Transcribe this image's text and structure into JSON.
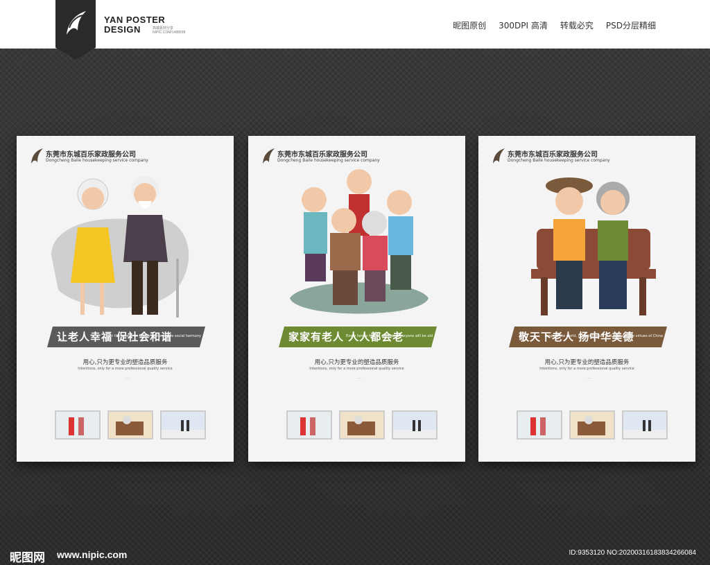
{
  "topbar": {
    "brand_line1": "YAN POSTER",
    "brand_line2": "DESIGN",
    "brand_small": "高端素材分享 NIPIC.COM/1488598",
    "features": [
      "昵图原创",
      "300DPI 高清",
      "转载必究",
      "PSD分层精细"
    ]
  },
  "posters": [
    {
      "company": "东莞市东城百乐家政服务公司",
      "company_en": "Dongcheng Baile housekeeping service company",
      "title": "让老人幸福  促社会和谐",
      "subtitle": "Let the elderly be happy and promote social harmony",
      "banner_color": "#5a5a5a",
      "slogan": "用心,只为更专业的塑造品质服务",
      "slogan_en": "Intentions, only for a more professional quality service",
      "body": "......"
    },
    {
      "company": "东莞市东城百乐家政服务公司",
      "company_en": "Dongcheng Baile housekeeping service company",
      "title": "家家有老人  人人都会老",
      "subtitle": "Every family has an old man, everyone will be old",
      "banner_color": "#6e8a32",
      "slogan": "用心,只为更专业的塑造品质服务",
      "slogan_en": "Intentions, only for a more professional quality service",
      "body": "......"
    },
    {
      "company": "东莞市东城百乐家政服务公司",
      "company_en": "Dongcheng Baile housekeeping service company",
      "title": "敬天下老人  扬中华美德",
      "subtitle": "Respect the world, respect the old and promote the virtues of China",
      "banner_color": "#7a5a3a",
      "slogan": "用心,只为更专业的塑造品质服务",
      "slogan_en": "Intentions, only for a more professional quality service",
      "body": "......"
    }
  ],
  "footer": {
    "site_logo": "昵图网",
    "url": "www.nipic.com",
    "id_text": "ID:9353120 NO:20200316183834266084"
  }
}
